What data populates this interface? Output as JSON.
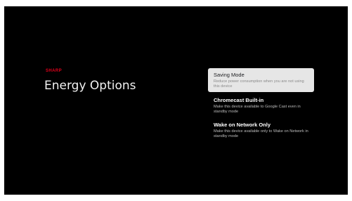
{
  "brand": "SHARP",
  "title": "Energy Options",
  "options": [
    {
      "title": "Saving Mode",
      "description": "Reduce power consumption when you are not using this device",
      "focused": true
    },
    {
      "title": "Chromecast Built-in",
      "description": "Make this device available to Google Cast even in standby mode",
      "focused": false
    },
    {
      "title": "Wake on Network Only",
      "description": "Make this device available only to Wake on Network in standby mode",
      "focused": false
    }
  ],
  "colors": {
    "background": "#000000",
    "brand": "#e3001b",
    "focus_highlight": "#e6e6e6",
    "text_primary": "#ffffff",
    "text_secondary": "#bdbdbd"
  }
}
